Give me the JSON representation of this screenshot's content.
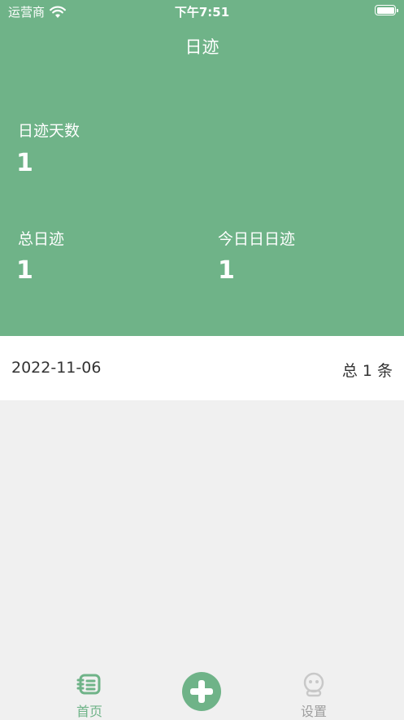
{
  "status_bar": {
    "carrier": "运营商",
    "time": "下午7:51"
  },
  "header": {
    "title": "日迹",
    "stats": {
      "days_label": "日迹天数",
      "days_value": "1",
      "total_label": "总日迹",
      "total_value": "1",
      "today_label": "今日日日迹",
      "today_value": "1"
    }
  },
  "list": {
    "rows": [
      {
        "date": "2022-11-06",
        "count": "总 1 条"
      }
    ]
  },
  "tabbar": {
    "home_label": "首页",
    "settings_label": "设置",
    "add_icon": "plus-circle-icon",
    "home_icon": "notebook-icon",
    "settings_icon": "robot-icon"
  },
  "colors": {
    "accent": "#6fb388",
    "background": "#f0f0f0",
    "inactive": "#9e9e9e"
  }
}
